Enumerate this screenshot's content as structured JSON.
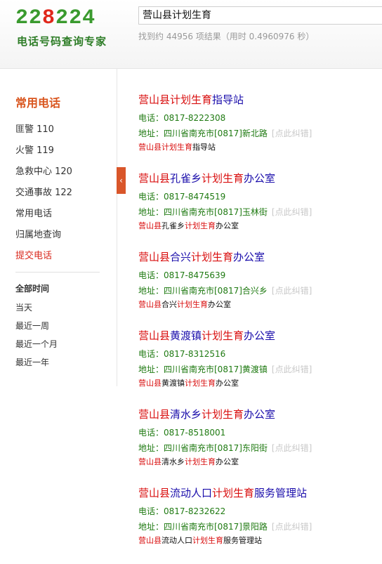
{
  "header": {
    "logo_digits": [
      {
        "d": "2",
        "color": "green"
      },
      {
        "d": "2",
        "color": "green"
      },
      {
        "d": "8",
        "color": "red"
      },
      {
        "d": "2",
        "color": "green"
      },
      {
        "d": "2",
        "color": "green"
      },
      {
        "d": "4",
        "color": "green"
      }
    ],
    "logo_tagline": "电话号码查询专家",
    "search_value": "营山县计划生育",
    "stats": "找到约 44956 项结果（用时 0.4960976 秒）"
  },
  "sidebar": {
    "title": "常用电话",
    "items": [
      {
        "label": "匪警 110",
        "highlight": false
      },
      {
        "label": "火警 119",
        "highlight": false
      },
      {
        "label": "急救中心 120",
        "highlight": false
      },
      {
        "label": "交通事故 122",
        "highlight": false
      },
      {
        "label": "常用电话",
        "highlight": false
      },
      {
        "label": "归属地查询",
        "highlight": false
      },
      {
        "label": "提交电话",
        "highlight": true
      }
    ],
    "time_title": "全部时间",
    "time_items": [
      "当天",
      "最近一周",
      "最近一个月",
      "最近一年"
    ],
    "collapse_glyph": "‹"
  },
  "results": [
    {
      "title": [
        {
          "t": "营山县计划生育",
          "hl": true
        },
        {
          "t": "指导站",
          "hl": false
        }
      ],
      "phone": "电话：0817-8222308",
      "address": "地址：四川省南充市[0817]新北路",
      "correct": "[点此纠错]",
      "snippet": [
        {
          "t": "营山县计划生育",
          "hl": true
        },
        {
          "t": "指导站",
          "hl": false
        }
      ]
    },
    {
      "title": [
        {
          "t": "营山县",
          "hl": true
        },
        {
          "t": "孔雀乡",
          "hl": false
        },
        {
          "t": "计划生育",
          "hl": true
        },
        {
          "t": "办公室",
          "hl": false
        }
      ],
      "phone": "电话：0817-8474519",
      "address": "地址：四川省南充市[0817]玉林街",
      "correct": "[点此纠错]",
      "snippet": [
        {
          "t": "营山县",
          "hl": true
        },
        {
          "t": "孔雀乡",
          "hl": false
        },
        {
          "t": "计划生育",
          "hl": true
        },
        {
          "t": "办公室",
          "hl": false
        }
      ]
    },
    {
      "title": [
        {
          "t": "营山县",
          "hl": true
        },
        {
          "t": "合兴",
          "hl": false
        },
        {
          "t": "计划生育",
          "hl": true
        },
        {
          "t": "办公室",
          "hl": false
        }
      ],
      "phone": "电话：0817-8475639",
      "address": "地址：四川省南充市[0817]合兴乡",
      "correct": "[点此纠错]",
      "snippet": [
        {
          "t": "营山县",
          "hl": true
        },
        {
          "t": "合兴",
          "hl": false
        },
        {
          "t": "计划生育",
          "hl": true
        },
        {
          "t": "办公室",
          "hl": false
        }
      ]
    },
    {
      "title": [
        {
          "t": "营山县",
          "hl": true
        },
        {
          "t": "黄渡镇",
          "hl": false
        },
        {
          "t": "计划生育",
          "hl": true
        },
        {
          "t": "办公室",
          "hl": false
        }
      ],
      "phone": "电话：0817-8312516",
      "address": "地址：四川省南充市[0817]黄渡镇",
      "correct": "[点此纠错]",
      "snippet": [
        {
          "t": "营山县",
          "hl": true
        },
        {
          "t": "黄渡镇",
          "hl": false
        },
        {
          "t": "计划生育",
          "hl": true
        },
        {
          "t": "办公室",
          "hl": false
        }
      ]
    },
    {
      "title": [
        {
          "t": "营山县",
          "hl": true
        },
        {
          "t": "清水乡",
          "hl": false
        },
        {
          "t": "计划生育",
          "hl": true
        },
        {
          "t": "办公室",
          "hl": false
        }
      ],
      "phone": "电话：0817-8518001",
      "address": "地址：四川省南充市[0817]东阳街",
      "correct": "[点此纠错]",
      "snippet": [
        {
          "t": "营山县",
          "hl": true
        },
        {
          "t": "清水乡",
          "hl": false
        },
        {
          "t": "计划生育",
          "hl": true
        },
        {
          "t": "办公室",
          "hl": false
        }
      ]
    },
    {
      "title": [
        {
          "t": "营山县",
          "hl": true
        },
        {
          "t": "流动人口",
          "hl": false
        },
        {
          "t": "计划生育",
          "hl": true
        },
        {
          "t": "服务管理站",
          "hl": false
        }
      ],
      "phone": "电话：0817-8232622",
      "address": "地址：四川省南充市[0817]景阳路",
      "correct": "[点此纠错]",
      "snippet": [
        {
          "t": "营山县",
          "hl": true
        },
        {
          "t": "流动人口",
          "hl": false
        },
        {
          "t": "计划生育",
          "hl": true
        },
        {
          "t": "服务管理站",
          "hl": false
        }
      ]
    }
  ]
}
